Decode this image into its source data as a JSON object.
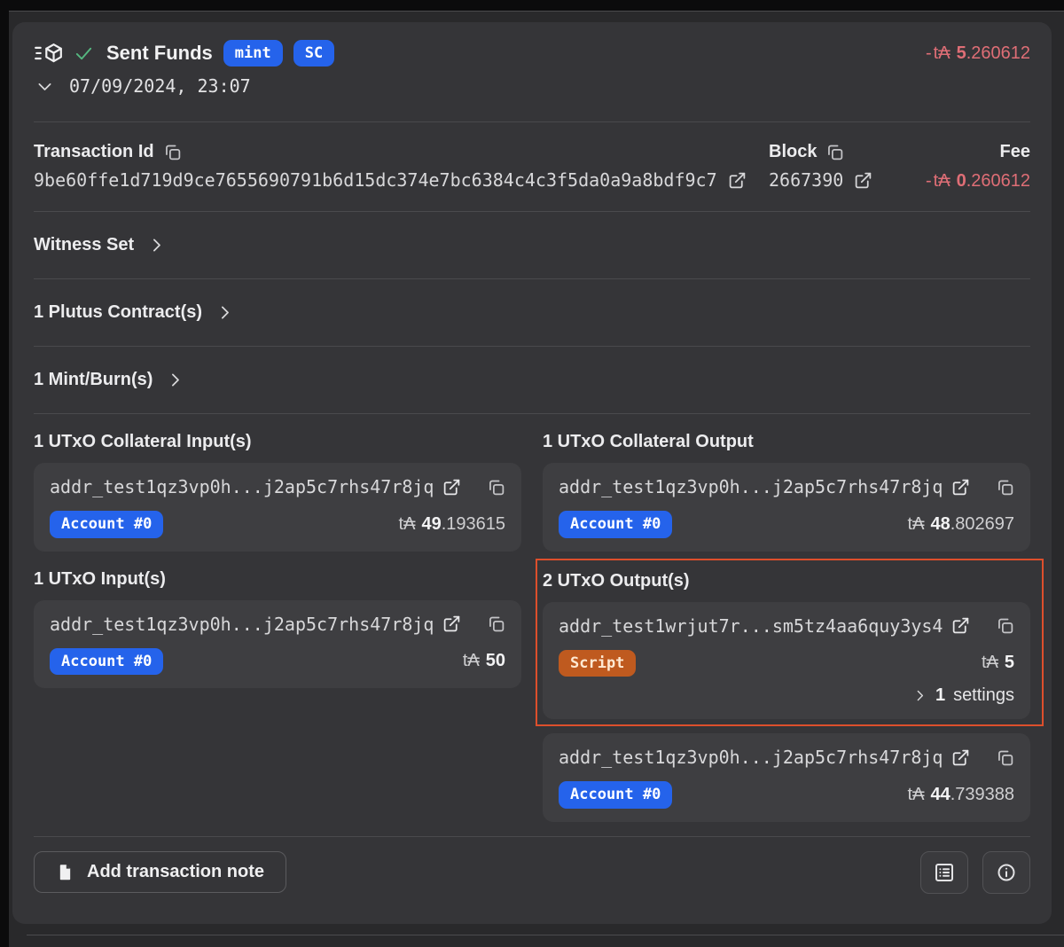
{
  "colors": {
    "accent_blue": "#2563eb",
    "accent_orange": "#bf5a1f",
    "negative_red": "#df6e76",
    "success_green": "#55b880",
    "highlight_border": "#dd4f2c",
    "panel_bg": "#353538",
    "card_bg": "#3e3e41"
  },
  "icons": [
    "tx-cube-icon",
    "success-check-icon",
    "chevron-down-icon",
    "chevron-right-icon",
    "copy-icon",
    "external-link-icon",
    "note-icon",
    "list-details-icon",
    "info-icon"
  ],
  "header": {
    "title": "Sent Funds",
    "badges": [
      "mint",
      "SC"
    ],
    "datetime": "07/09/2024, 23:07",
    "amount": {
      "sign": "-",
      "cur": "t₳",
      "int": "5",
      "dec": ".260612"
    }
  },
  "tx": {
    "id_label": "Transaction Id",
    "id_value": "9be60ffe1d719d9ce7655690791b6d15dc374e7bc6384c4c3f5da0a9a8bdf9c7",
    "block_label": "Block",
    "block_value": "2667390",
    "fee_label": "Fee",
    "fee": {
      "sign": "-",
      "cur": "t₳",
      "int": "0",
      "dec": ".260612"
    }
  },
  "sections": {
    "witness": "Witness Set",
    "plutus": "1 Plutus Contract(s)",
    "mint_burn": "1 Mint/Burn(s)"
  },
  "utxo": {
    "collateral_inputs": {
      "heading": "1 UTxO Collateral Input(s)",
      "address": "addr_test1qz3vp0h...j2ap5c7rhs47r8jq",
      "account": "Account #0",
      "amount": {
        "cur": "t₳",
        "int": "49",
        "dec": ".193615"
      }
    },
    "collateral_output": {
      "heading": "1 UTxO Collateral Output",
      "address": "addr_test1qz3vp0h...j2ap5c7rhs47r8jq",
      "account": "Account #0",
      "amount": {
        "cur": "t₳",
        "int": "48",
        "dec": ".802697"
      }
    },
    "inputs": {
      "heading": "1 UTxO Input(s)",
      "address": "addr_test1qz3vp0h...j2ap5c7rhs47r8jq",
      "account": "Account #0",
      "amount": {
        "cur": "t₳",
        "int": "50",
        "dec": ""
      }
    },
    "outputs": {
      "heading": "2 UTxO Output(s)",
      "script_output": {
        "address": "addr_test1wrjut7r...sm5tz4aa6quy3ys4",
        "badge": "Script",
        "amount": {
          "cur": "t₳",
          "int": "5",
          "dec": ""
        },
        "settings_count": "1",
        "settings_label": "settings"
      },
      "change_output": {
        "address": "addr_test1qz3vp0h...j2ap5c7rhs47r8jq",
        "account": "Account #0",
        "amount": {
          "cur": "t₳",
          "int": "44",
          "dec": ".739388"
        }
      }
    }
  },
  "footer": {
    "note_button": "Add transaction note"
  }
}
